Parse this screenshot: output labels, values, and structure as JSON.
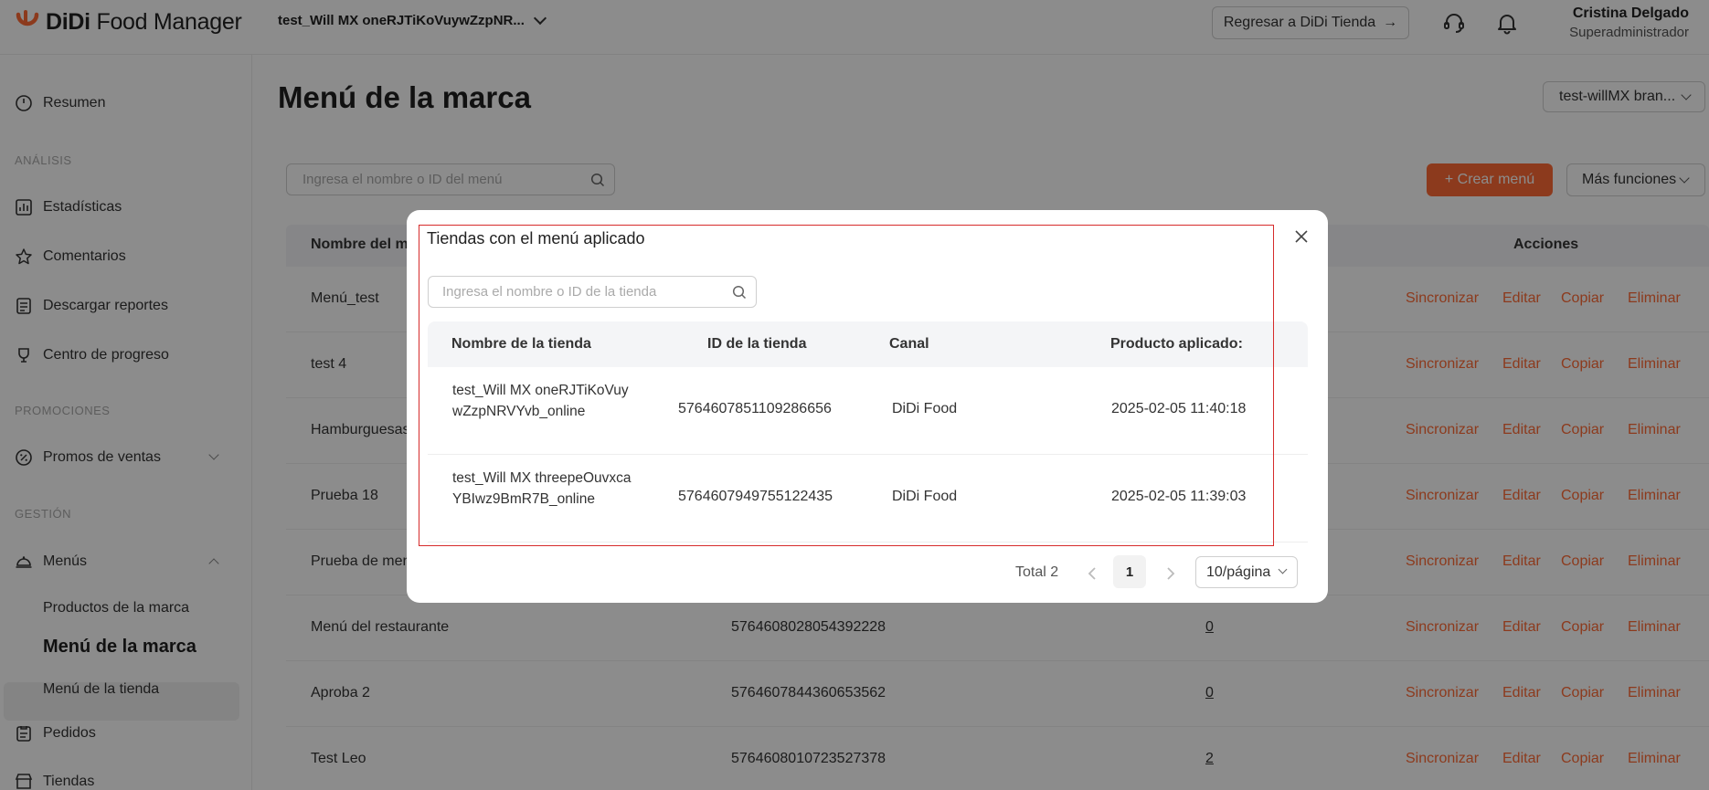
{
  "app": {
    "logo_brand": "DiDi",
    "logo_product": "Food Manager",
    "brand_color": "#ff6b35"
  },
  "header": {
    "store_name": "test_Will MX oneRJTiKoVuywZzpNR...",
    "back_button": "Regresar a DiDi Tienda",
    "back_arrow": "→",
    "support_icon": "headset-icon",
    "notification_icon": "bell-icon",
    "user_name": "Cristina Delgado",
    "user_role": "Superadministrador"
  },
  "sidebar": {
    "resumen": "Resumen",
    "section_analisis": "ANÁLISIS",
    "estadisticas": "Estadísticas",
    "comentarios": "Comentarios",
    "descargar_reportes": "Descargar reportes",
    "centro_progreso": "Centro de progreso",
    "section_promociones": "PROMOCIONES",
    "promos_ventas": "Promos de ventas",
    "section_gestion": "GESTIÓN",
    "menus": "Menús",
    "productos_marca": "Productos de la marca",
    "menu_marca": "Menú de la marca",
    "menu_tienda": "Menú de la tienda",
    "pedidos": "Pedidos",
    "tiendas": "Tiendas"
  },
  "main": {
    "title": "Menú de la marca",
    "brand_selector": "test-willMX bran...",
    "search_placeholder": "Ingresa el nombre o ID del menú",
    "create_button": "+ Crear menú",
    "more_button": "Más funciones",
    "col_name": "Nombre del me",
    "col_actions": "Acciones",
    "actions": {
      "sync": "Sincronizar",
      "edit": "Editar",
      "copy": "Copiar",
      "delete": "Eliminar"
    },
    "rows": [
      {
        "name": "Menú_test",
        "id": "",
        "count": ""
      },
      {
        "name": "test 4",
        "id": "",
        "count": ""
      },
      {
        "name": "Hamburguesas",
        "id": "",
        "count": ""
      },
      {
        "name": "Prueba 18",
        "id": "",
        "count": ""
      },
      {
        "name": "Prueba de men",
        "id": "",
        "count": ""
      },
      {
        "name": "Menú del restaurante",
        "id": "5764608028054392228",
        "count": "0"
      },
      {
        "name": "Aproba 2",
        "id": "5764607844360653562",
        "count": "0"
      },
      {
        "name": "Test Leo",
        "id": "5764608010723527378",
        "count": "2"
      }
    ]
  },
  "modal": {
    "title": "Tiendas con el menú aplicado",
    "search_placeholder": "Ingresa el nombre o ID de la tienda",
    "col_store_name": "Nombre de la tienda",
    "col_store_id": "ID de la tienda",
    "col_channel": "Canal",
    "col_applied": "Producto aplicado:",
    "rows": [
      {
        "name": "test_Will MX oneRJTiKoVuywZzpNRVYvb_online",
        "id": "5764607851109286656",
        "channel": "DiDi Food",
        "applied": "2025-02-05 11:40:18"
      },
      {
        "name": "test_Will MX threepeOuvxcaYBIwz9BmR7B_online",
        "id": "5764607949755122435",
        "channel": "DiDi Food",
        "applied": "2025-02-05 11:39:03"
      }
    ],
    "pagination": {
      "total": "Total 2",
      "current_page": "1",
      "page_size": "10/página"
    }
  }
}
